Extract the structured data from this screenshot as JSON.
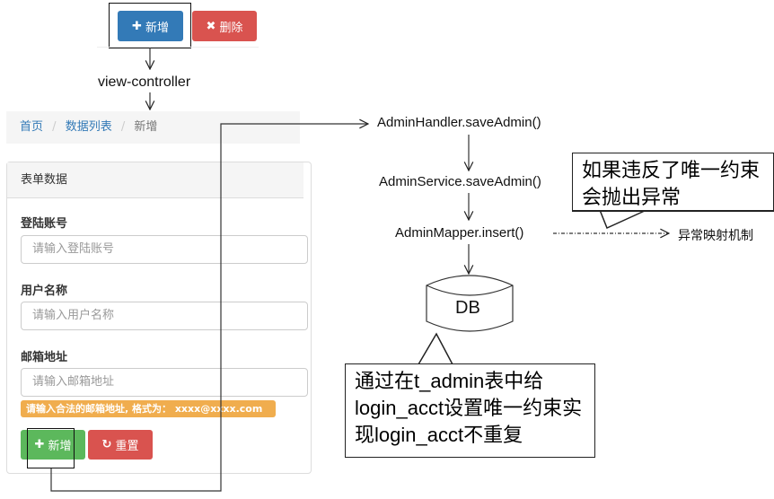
{
  "top": {
    "add_label": "新增",
    "delete_label": "删除"
  },
  "flow": {
    "view_controller": "view-controller",
    "handler": "AdminHandler.saveAdmin()",
    "service": "AdminService.saveAdmin()",
    "mapper": "AdminMapper.insert()",
    "db": "DB",
    "exception_mapping": "异常映射机制"
  },
  "breadcrumb": {
    "items": [
      "首页",
      "数据列表",
      "新增"
    ],
    "sep": "/"
  },
  "form": {
    "panel_title": "表单数据",
    "fields": [
      {
        "label": "登陆账号",
        "placeholder": "请输入登陆账号"
      },
      {
        "label": "用户名称",
        "placeholder": "请输入用户名称"
      },
      {
        "label": "邮箱地址",
        "placeholder": "请输入邮箱地址"
      }
    ],
    "email_hint": "请输入合法的邮箱地址, 格式为： xxxx@xxxx.com",
    "submit_label": "新增",
    "reset_label": "重置"
  },
  "callouts": {
    "unique_exception": "如果违反了唯一约束会抛出异常",
    "unique_constraint": "通过在t_admin表中给login_acct设置唯一约束实现login_acct不重复"
  },
  "colors": {
    "primary": "#337ab7",
    "danger": "#d9534f",
    "success": "#5cb85c",
    "warning": "#f0ad4e"
  }
}
